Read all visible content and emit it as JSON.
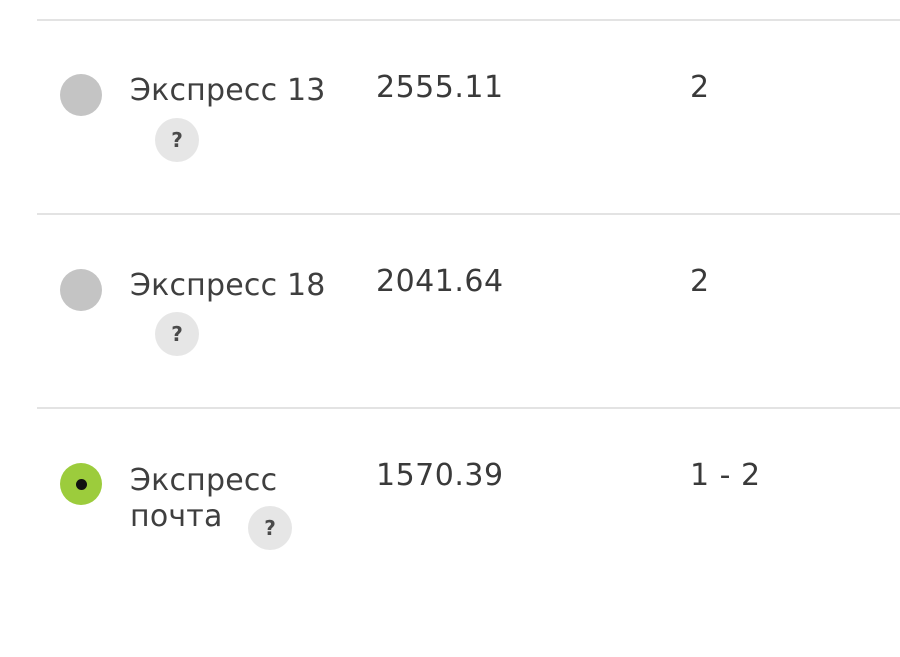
{
  "rows": [
    {
      "name_line1": "Экспресс 13",
      "name_line2": "",
      "price": "2555.11",
      "days": "2",
      "selected": false,
      "help_label": "?"
    },
    {
      "name_line1": "Экспресс 18",
      "name_line2": "",
      "price": "2041.64",
      "days": "2",
      "selected": false,
      "help_label": "?"
    },
    {
      "name_line1": "Экспресс",
      "name_line2": "почта",
      "price": "1570.39",
      "days": "1 - 2",
      "selected": true,
      "help_label": "?"
    }
  ],
  "colors": {
    "radio_selected": "#9ccc3c",
    "radio_unselected": "#c4c4c4",
    "divider": "#e3e3e3"
  },
  "icons": {
    "help": "question-mark-icon",
    "radio": "radio-button-icon"
  }
}
